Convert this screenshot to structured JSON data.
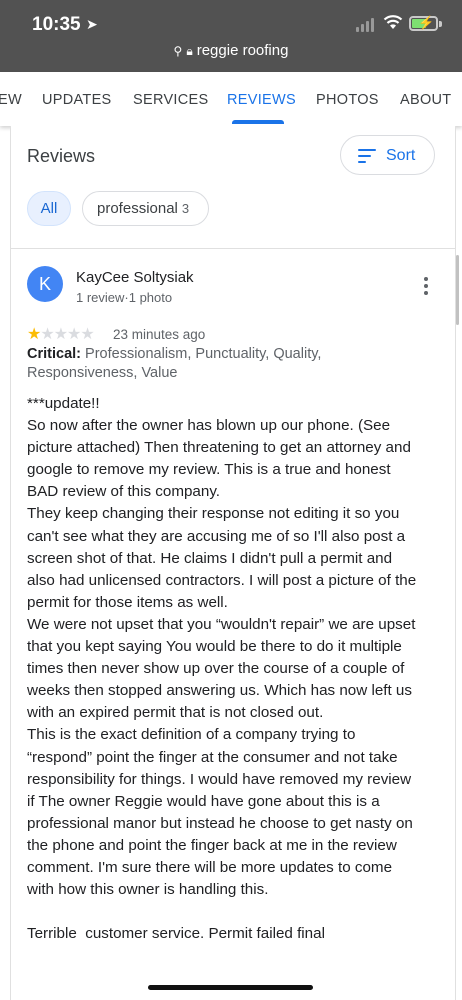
{
  "status": {
    "time": "10:35",
    "url": "reggie roofing"
  },
  "tabs": [
    "EW",
    "UPDATES",
    "SERVICES",
    "REVIEWS",
    "PHOTOS",
    "ABOUT"
  ],
  "reviews_header": {
    "title": "Reviews",
    "sort_label": "Sort"
  },
  "filters": {
    "all": "All",
    "professional": "professional",
    "professional_count": "3"
  },
  "review": {
    "avatar_letter": "K",
    "author": "KayCee Soltysiak",
    "author_meta": "1 review·1 photo",
    "rating": 1,
    "time_ago": "23 minutes ago",
    "critical_label": "Critical:",
    "critical_items": "Professionalism, Punctuality, Quality, Responsiveness, Value",
    "text": "***update!!\nSo now after the owner has blown up our phone. (See picture attached) Then threatening to get an attorney and google to remove my review. This is a true and honest BAD review of this company.\nThey keep changing their response not editing it so you can't see what they are accusing me of so I'll also post a screen shot of that. He claims I didn't pull a permit and also had unlicensed contractors. I will post a picture of the permit for those items as well.\nWe were not upset that you “wouldn't repair” we are upset that you kept saying You would be there to do it multiple times then never show up over the course of a couple of weeks then stopped answering us. Which has now left us with an expired permit that is not closed out.\nThis is the exact definition of a company trying to “respond” point the finger at the consumer and not take responsibility for things. I would have removed my review if The owner Reggie would have gone about this is a professional manor but instead he choose to get nasty on the phone and point the finger back at me in the review comment. I'm sure there will be more updates to come with how this owner is handling this.\n\nTerrible  customer service. Permit failed final"
  },
  "colors": {
    "accent": "#1a73e8",
    "star": "#fbbc04",
    "avatar": "#4285f4"
  }
}
